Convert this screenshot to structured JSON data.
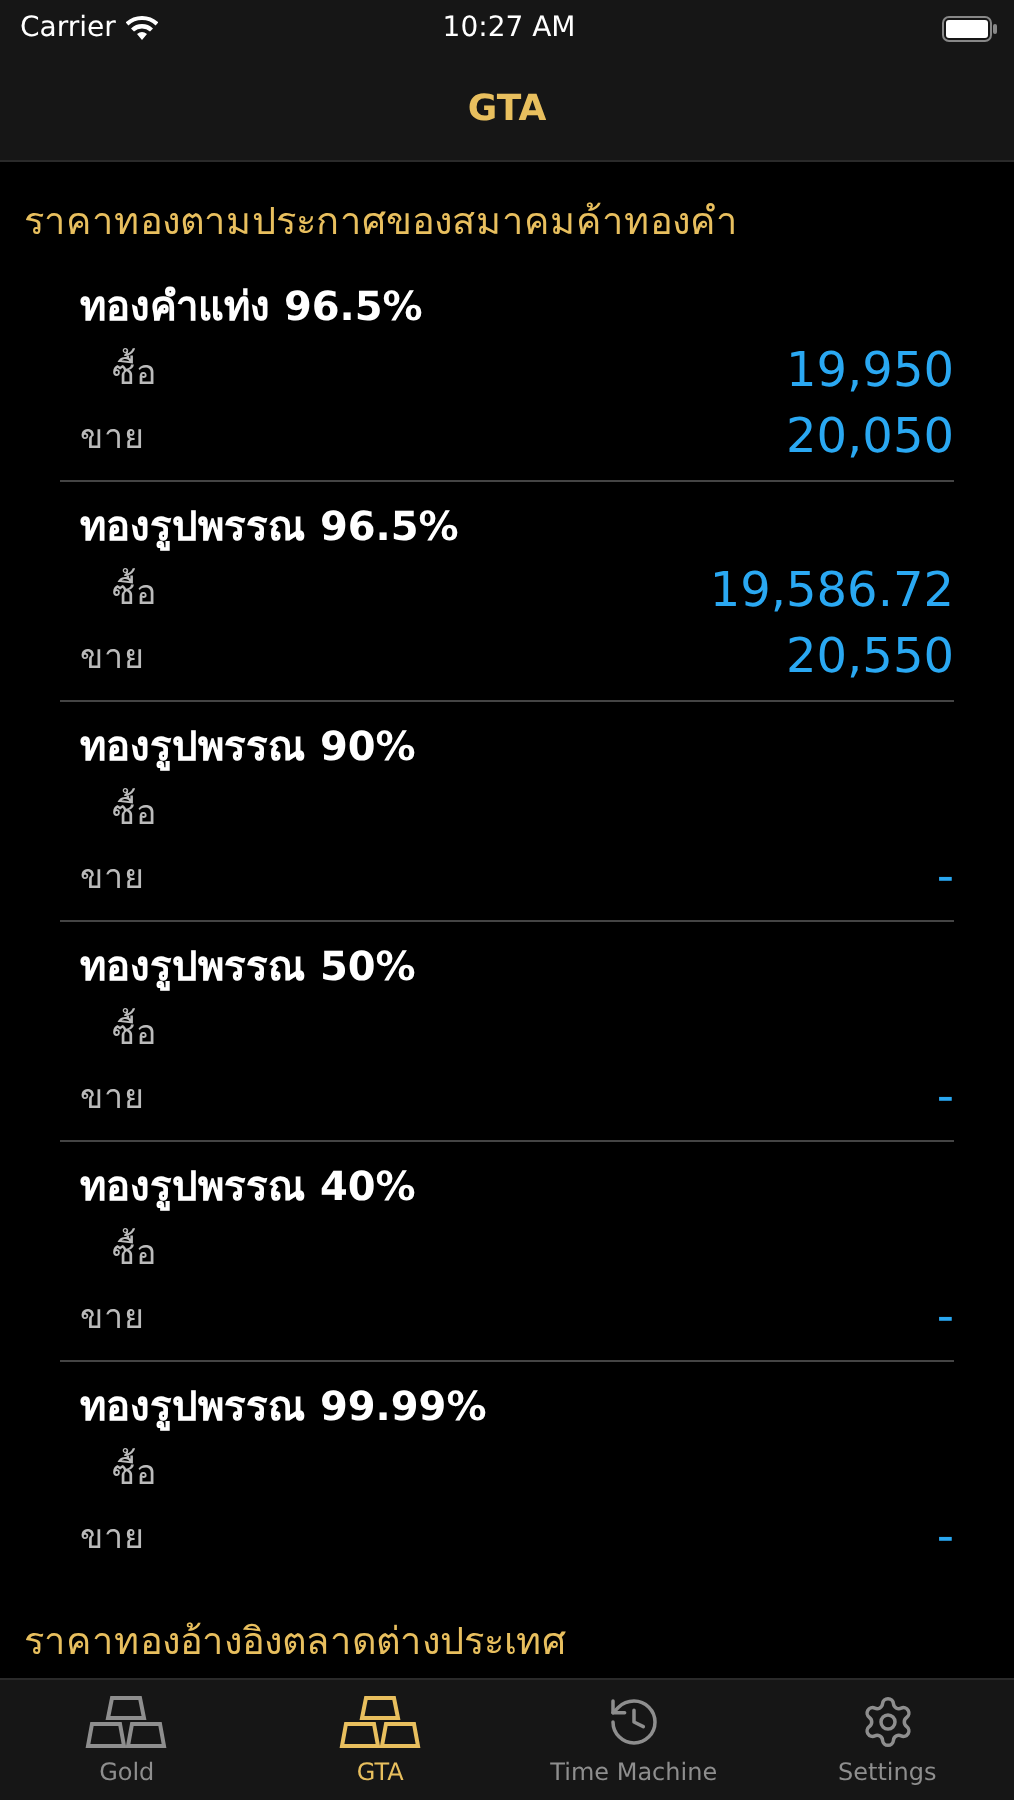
{
  "status_bar": {
    "carrier": "Carrier",
    "time": "10:27 AM"
  },
  "nav": {
    "title": "GTA"
  },
  "section_title": "ราคาทองตามประกาศของสมาคมค้าทองคำ",
  "items": [
    {
      "name": "ทองคำแท่ง 96.5%",
      "buy_label": "ซื้อ",
      "buy": "19,950",
      "sell_label": "ขาย",
      "sell": "20,050"
    },
    {
      "name": "ทองรูปพรรณ 96.5%",
      "buy_label": "ซื้อ",
      "buy": "19,586.72",
      "sell_label": "ขาย",
      "sell": "20,550"
    },
    {
      "name": "ทองรูปพรรณ 90%",
      "buy_label": "ซื้อ",
      "sell_label": "ขาย",
      "sell": "-"
    },
    {
      "name": "ทองรูปพรรณ 50%",
      "buy_label": "ซื้อ",
      "sell_label": "ขาย",
      "sell": "-"
    },
    {
      "name": "ทองรูปพรรณ 40%",
      "buy_label": "ซื้อ",
      "sell_label": "ขาย",
      "sell": "-"
    },
    {
      "name": "ทองรูปพรรณ 99.99%",
      "buy_label": "ซื้อ",
      "sell_label": "ขาย",
      "sell": "-"
    }
  ],
  "next_section_title": "ราคาทองอ้างอิงตลาดต่างประเทศ",
  "tabs": [
    {
      "label": "Gold",
      "kind": "bars",
      "selected": false
    },
    {
      "label": "GTA",
      "kind": "bars",
      "selected": true
    },
    {
      "label": "Time Machine",
      "kind": "history",
      "selected": false
    },
    {
      "label": "Settings",
      "kind": "gear",
      "selected": false
    }
  ]
}
